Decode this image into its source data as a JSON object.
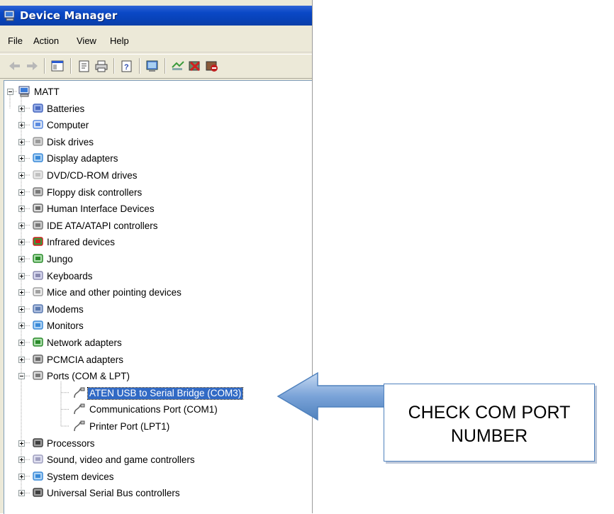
{
  "window": {
    "title": "Device Manager"
  },
  "menu": [
    "File",
    "Action",
    "View",
    "Help"
  ],
  "toolbar": {
    "buttons": [
      "back-icon",
      "forward-icon",
      "show-hide-console-tree-icon",
      "properties-icon",
      "print-icon",
      "help-icon",
      "scan-hardware-icon",
      "update-driver-icon",
      "uninstall-icon",
      "disable-icon"
    ]
  },
  "tree": {
    "root": "MATT",
    "items": [
      {
        "label": "Batteries",
        "icon": "battery-icon"
      },
      {
        "label": "Computer",
        "icon": "computer-icon"
      },
      {
        "label": "Disk drives",
        "icon": "disk-drive-icon"
      },
      {
        "label": "Display adapters",
        "icon": "display-adapter-icon"
      },
      {
        "label": "DVD/CD-ROM drives",
        "icon": "dvd-drive-icon"
      },
      {
        "label": "Floppy disk controllers",
        "icon": "floppy-controller-icon"
      },
      {
        "label": "Human Interface Devices",
        "icon": "hid-icon"
      },
      {
        "label": "IDE ATA/ATAPI controllers",
        "icon": "ide-controller-icon"
      },
      {
        "label": "Infrared devices",
        "icon": "infrared-icon"
      },
      {
        "label": "Jungo",
        "icon": "jungo-board-icon"
      },
      {
        "label": "Keyboards",
        "icon": "keyboard-icon"
      },
      {
        "label": "Mice and other pointing devices",
        "icon": "mouse-icon"
      },
      {
        "label": "Modems",
        "icon": "modem-icon"
      },
      {
        "label": "Monitors",
        "icon": "monitor-icon"
      },
      {
        "label": "Network adapters",
        "icon": "network-adapter-icon"
      },
      {
        "label": "PCMCIA adapters",
        "icon": "pcmcia-icon"
      },
      {
        "label": "Ports (COM & LPT)",
        "icon": "port-icon"
      },
      {
        "label": "Processors",
        "icon": "processor-icon"
      },
      {
        "label": "Sound, video and game controllers",
        "icon": "sound-icon"
      },
      {
        "label": "System devices",
        "icon": "system-device-icon"
      },
      {
        "label": "Universal Serial Bus controllers",
        "icon": "usb-icon"
      }
    ],
    "ports_children": [
      {
        "label": "ATEN USB to Serial Bridge (COM3)",
        "selected": true
      },
      {
        "label": "Communications Port (COM1)",
        "selected": false
      },
      {
        "label": "Printer Port (LPT1)",
        "selected": false
      }
    ]
  },
  "callout": {
    "line1": "CHECK COM PORT",
    "line2": "NUMBER"
  },
  "colors": {
    "titlebar": "#0a48c6",
    "selection": "#316ac5",
    "arrow": "#4f81bd"
  }
}
